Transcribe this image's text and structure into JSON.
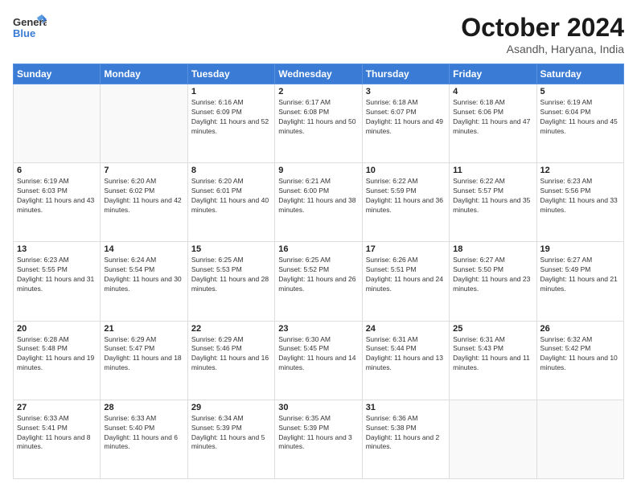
{
  "logo": {
    "general": "General",
    "blue": "Blue"
  },
  "title": "October 2024",
  "location": "Asandh, Haryana, India",
  "days_header": [
    "Sunday",
    "Monday",
    "Tuesday",
    "Wednesday",
    "Thursday",
    "Friday",
    "Saturday"
  ],
  "weeks": [
    [
      {
        "day": "",
        "info": ""
      },
      {
        "day": "",
        "info": ""
      },
      {
        "day": "1",
        "info": "Sunrise: 6:16 AM\nSunset: 6:09 PM\nDaylight: 11 hours and 52 minutes."
      },
      {
        "day": "2",
        "info": "Sunrise: 6:17 AM\nSunset: 6:08 PM\nDaylight: 11 hours and 50 minutes."
      },
      {
        "day": "3",
        "info": "Sunrise: 6:18 AM\nSunset: 6:07 PM\nDaylight: 11 hours and 49 minutes."
      },
      {
        "day": "4",
        "info": "Sunrise: 6:18 AM\nSunset: 6:06 PM\nDaylight: 11 hours and 47 minutes."
      },
      {
        "day": "5",
        "info": "Sunrise: 6:19 AM\nSunset: 6:04 PM\nDaylight: 11 hours and 45 minutes."
      }
    ],
    [
      {
        "day": "6",
        "info": "Sunrise: 6:19 AM\nSunset: 6:03 PM\nDaylight: 11 hours and 43 minutes."
      },
      {
        "day": "7",
        "info": "Sunrise: 6:20 AM\nSunset: 6:02 PM\nDaylight: 11 hours and 42 minutes."
      },
      {
        "day": "8",
        "info": "Sunrise: 6:20 AM\nSunset: 6:01 PM\nDaylight: 11 hours and 40 minutes."
      },
      {
        "day": "9",
        "info": "Sunrise: 6:21 AM\nSunset: 6:00 PM\nDaylight: 11 hours and 38 minutes."
      },
      {
        "day": "10",
        "info": "Sunrise: 6:22 AM\nSunset: 5:59 PM\nDaylight: 11 hours and 36 minutes."
      },
      {
        "day": "11",
        "info": "Sunrise: 6:22 AM\nSunset: 5:57 PM\nDaylight: 11 hours and 35 minutes."
      },
      {
        "day": "12",
        "info": "Sunrise: 6:23 AM\nSunset: 5:56 PM\nDaylight: 11 hours and 33 minutes."
      }
    ],
    [
      {
        "day": "13",
        "info": "Sunrise: 6:23 AM\nSunset: 5:55 PM\nDaylight: 11 hours and 31 minutes."
      },
      {
        "day": "14",
        "info": "Sunrise: 6:24 AM\nSunset: 5:54 PM\nDaylight: 11 hours and 30 minutes."
      },
      {
        "day": "15",
        "info": "Sunrise: 6:25 AM\nSunset: 5:53 PM\nDaylight: 11 hours and 28 minutes."
      },
      {
        "day": "16",
        "info": "Sunrise: 6:25 AM\nSunset: 5:52 PM\nDaylight: 11 hours and 26 minutes."
      },
      {
        "day": "17",
        "info": "Sunrise: 6:26 AM\nSunset: 5:51 PM\nDaylight: 11 hours and 24 minutes."
      },
      {
        "day": "18",
        "info": "Sunrise: 6:27 AM\nSunset: 5:50 PM\nDaylight: 11 hours and 23 minutes."
      },
      {
        "day": "19",
        "info": "Sunrise: 6:27 AM\nSunset: 5:49 PM\nDaylight: 11 hours and 21 minutes."
      }
    ],
    [
      {
        "day": "20",
        "info": "Sunrise: 6:28 AM\nSunset: 5:48 PM\nDaylight: 11 hours and 19 minutes."
      },
      {
        "day": "21",
        "info": "Sunrise: 6:29 AM\nSunset: 5:47 PM\nDaylight: 11 hours and 18 minutes."
      },
      {
        "day": "22",
        "info": "Sunrise: 6:29 AM\nSunset: 5:46 PM\nDaylight: 11 hours and 16 minutes."
      },
      {
        "day": "23",
        "info": "Sunrise: 6:30 AM\nSunset: 5:45 PM\nDaylight: 11 hours and 14 minutes."
      },
      {
        "day": "24",
        "info": "Sunrise: 6:31 AM\nSunset: 5:44 PM\nDaylight: 11 hours and 13 minutes."
      },
      {
        "day": "25",
        "info": "Sunrise: 6:31 AM\nSunset: 5:43 PM\nDaylight: 11 hours and 11 minutes."
      },
      {
        "day": "26",
        "info": "Sunrise: 6:32 AM\nSunset: 5:42 PM\nDaylight: 11 hours and 10 minutes."
      }
    ],
    [
      {
        "day": "27",
        "info": "Sunrise: 6:33 AM\nSunset: 5:41 PM\nDaylight: 11 hours and 8 minutes."
      },
      {
        "day": "28",
        "info": "Sunrise: 6:33 AM\nSunset: 5:40 PM\nDaylight: 11 hours and 6 minutes."
      },
      {
        "day": "29",
        "info": "Sunrise: 6:34 AM\nSunset: 5:39 PM\nDaylight: 11 hours and 5 minutes."
      },
      {
        "day": "30",
        "info": "Sunrise: 6:35 AM\nSunset: 5:39 PM\nDaylight: 11 hours and 3 minutes."
      },
      {
        "day": "31",
        "info": "Sunrise: 6:36 AM\nSunset: 5:38 PM\nDaylight: 11 hours and 2 minutes."
      },
      {
        "day": "",
        "info": ""
      },
      {
        "day": "",
        "info": ""
      }
    ]
  ]
}
